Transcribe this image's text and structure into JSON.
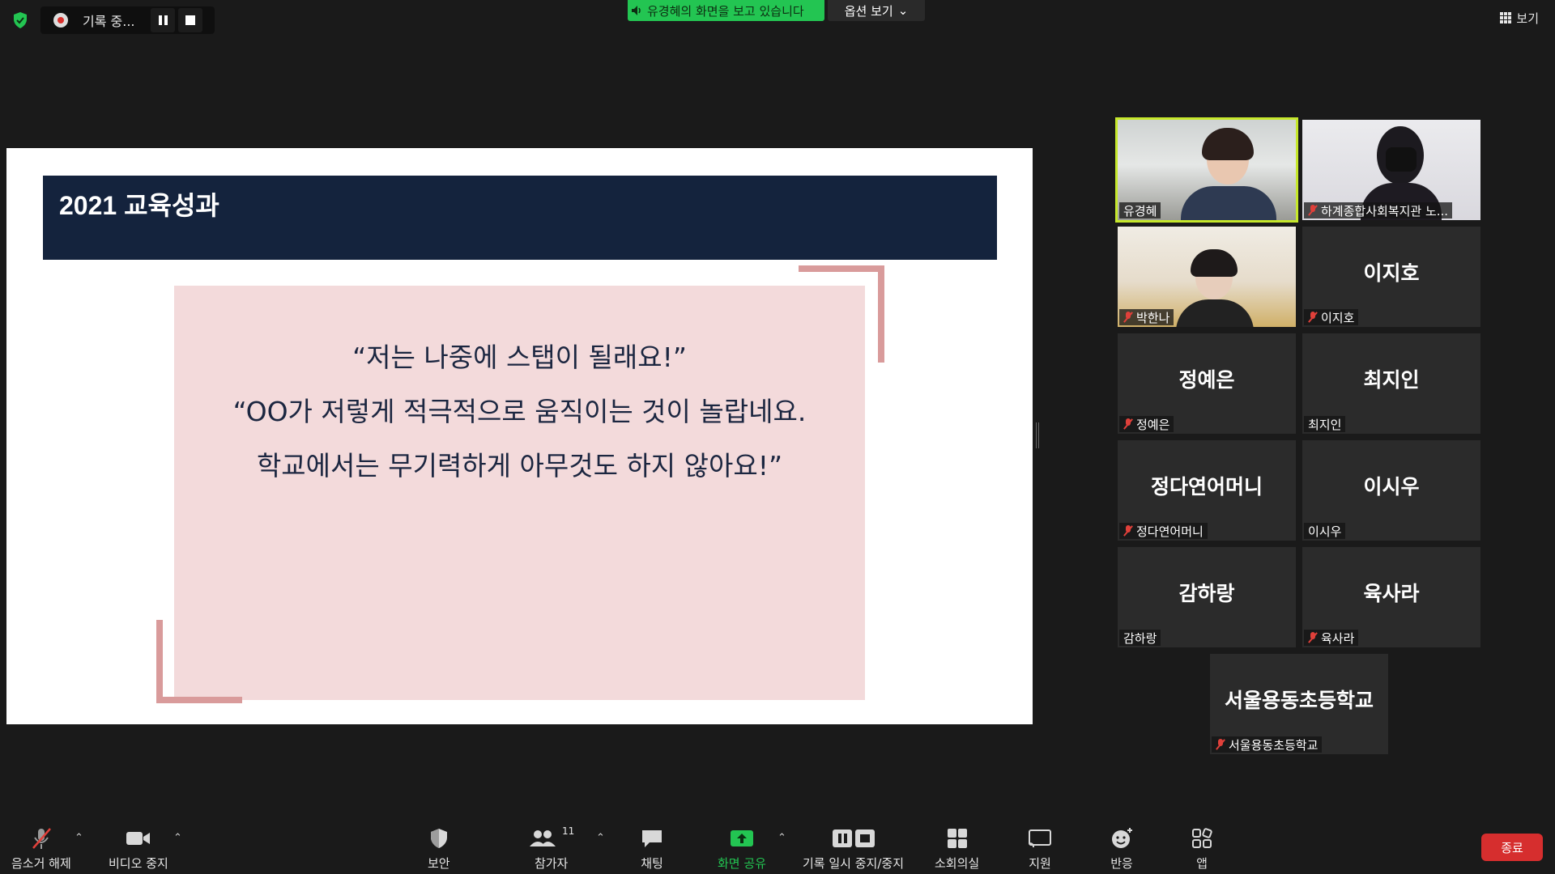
{
  "topbar": {
    "recording_label": "기록 중...",
    "share_banner": "유경혜의 화면을 보고 있습니다",
    "view_options": "옵션 보기",
    "view": "보기"
  },
  "slide": {
    "title": "2021 교육성과",
    "quotes": [
      "“저는 나중에 스탭이 될래요!”",
      "“OO가 저렇게 적극적으로 움직이는 것이 놀랍네요.",
      "학교에서는 무기력하게 아무것도 하지 않아요!”"
    ]
  },
  "participants": [
    {
      "label": "유경혜",
      "center_name": "",
      "muted": false,
      "video": true,
      "active": true
    },
    {
      "label": "하계종합사회복지관 노...",
      "center_name": "",
      "muted": true,
      "video": true,
      "active": false
    },
    {
      "label": "박한나",
      "center_name": "",
      "muted": true,
      "video": true,
      "active": false
    },
    {
      "label": "이지호",
      "center_name": "이지호",
      "muted": true,
      "video": false,
      "active": false
    },
    {
      "label": "정예은",
      "center_name": "정예은",
      "muted": true,
      "video": false,
      "active": false
    },
    {
      "label": "최지인",
      "center_name": "최지인",
      "muted": false,
      "video": false,
      "active": false
    },
    {
      "label": "정다연어머니",
      "center_name": "정다연어머니",
      "muted": true,
      "video": false,
      "active": false
    },
    {
      "label": "이시우",
      "center_name": "이시우",
      "muted": false,
      "video": false,
      "active": false
    },
    {
      "label": "감하랑",
      "center_name": "감하랑",
      "muted": false,
      "video": false,
      "active": false
    },
    {
      "label": "육사라",
      "center_name": "육사라",
      "muted": true,
      "video": false,
      "active": false
    },
    {
      "label": "서울용동초등학교",
      "center_name": "서울용동초등학교",
      "muted": true,
      "video": false,
      "active": false
    }
  ],
  "toolbar": {
    "unmute": "음소거 해제",
    "stop_video": "비디오 중지",
    "security": "보안",
    "participants": "참가자",
    "participants_count": "11",
    "chat": "채팅",
    "share_screen": "화면 공유",
    "pause_stop_recording": "기록 일시 중지/중지",
    "breakout_rooms": "소회의실",
    "support": "지원",
    "reactions": "반응",
    "apps": "앱",
    "end": "종료"
  },
  "colors": {
    "share_green": "#23c552",
    "active_speaker": "#c6e82b",
    "slide_header": "#14233d",
    "quote_box": "#f3dadb",
    "accent_corner": "#d99b9b",
    "end_red": "#d62e2e"
  }
}
